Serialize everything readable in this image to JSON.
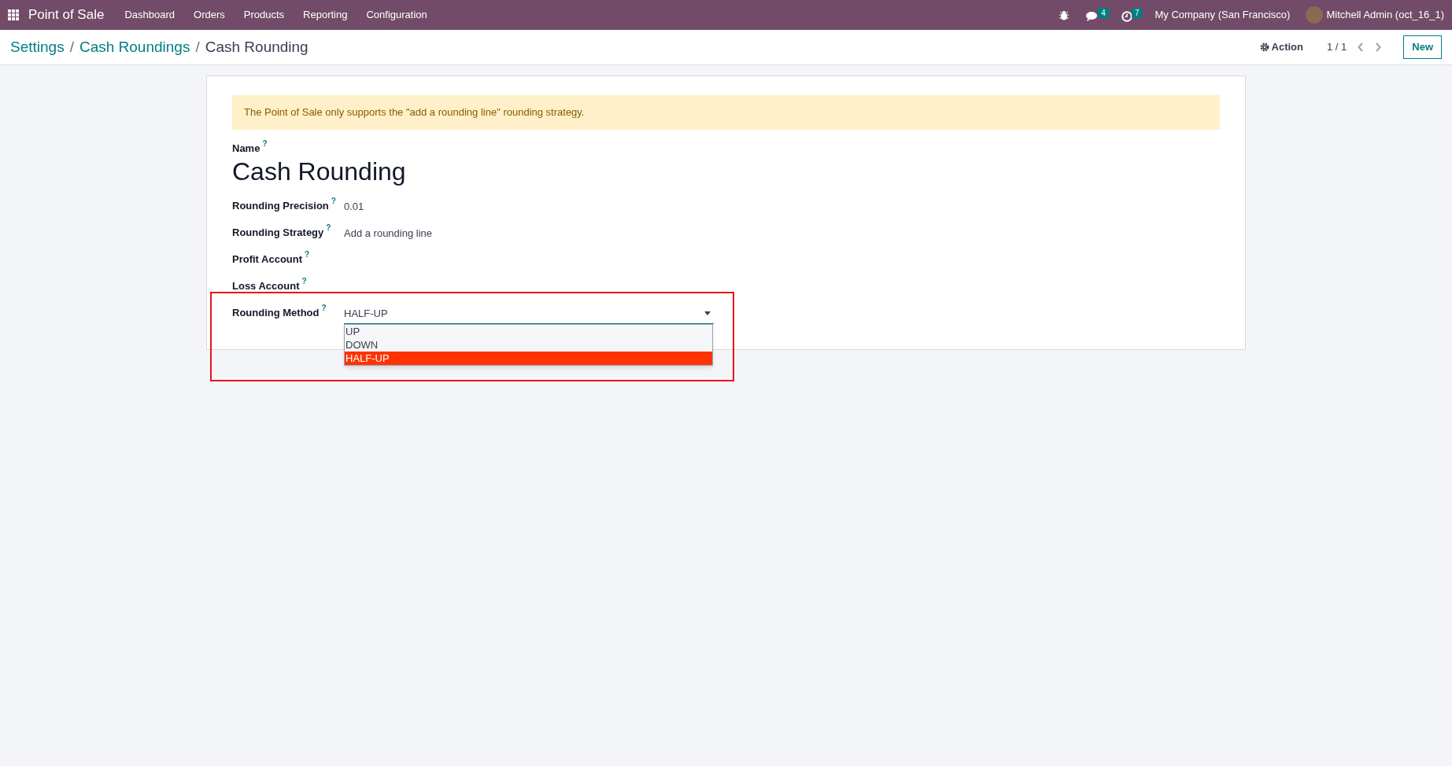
{
  "navbar": {
    "app_name": "Point of Sale",
    "menu": [
      "Dashboard",
      "Orders",
      "Products",
      "Reporting",
      "Configuration"
    ],
    "messages_count": "4",
    "activities_count": "7",
    "company": "My Company (San Francisco)",
    "user": "Mitchell Admin (oct_16_1)"
  },
  "control_panel": {
    "separator": "/",
    "breadcrumbs": [
      {
        "label": "Settings",
        "current": false
      },
      {
        "label": "Cash Roundings",
        "current": false
      },
      {
        "label": "Cash Rounding",
        "current": true
      }
    ],
    "action": "Action",
    "pager": "1 / 1",
    "new_button": "New"
  },
  "form": {
    "alert": "The Point of Sale only supports the \"add a rounding line\" rounding strategy.",
    "name_label": "Name",
    "help_mark": "?",
    "name": "Cash Rounding",
    "fields": [
      {
        "kind": "text",
        "label": "Rounding Precision",
        "value": "0.01"
      },
      {
        "kind": "text",
        "label": "Rounding Strategy",
        "value": "Add a rounding line"
      },
      {
        "kind": "text",
        "label": "Profit Account"
      },
      {
        "kind": "text",
        "label": "Loss Account"
      },
      {
        "kind": "select",
        "label": "Rounding Method",
        "value": "HALF-UP",
        "expanded": true,
        "options": [
          {
            "label": "UP",
            "selected": false
          },
          {
            "label": "DOWN",
            "selected": false
          },
          {
            "label": "HALF-UP",
            "selected": true
          }
        ]
      }
    ]
  }
}
